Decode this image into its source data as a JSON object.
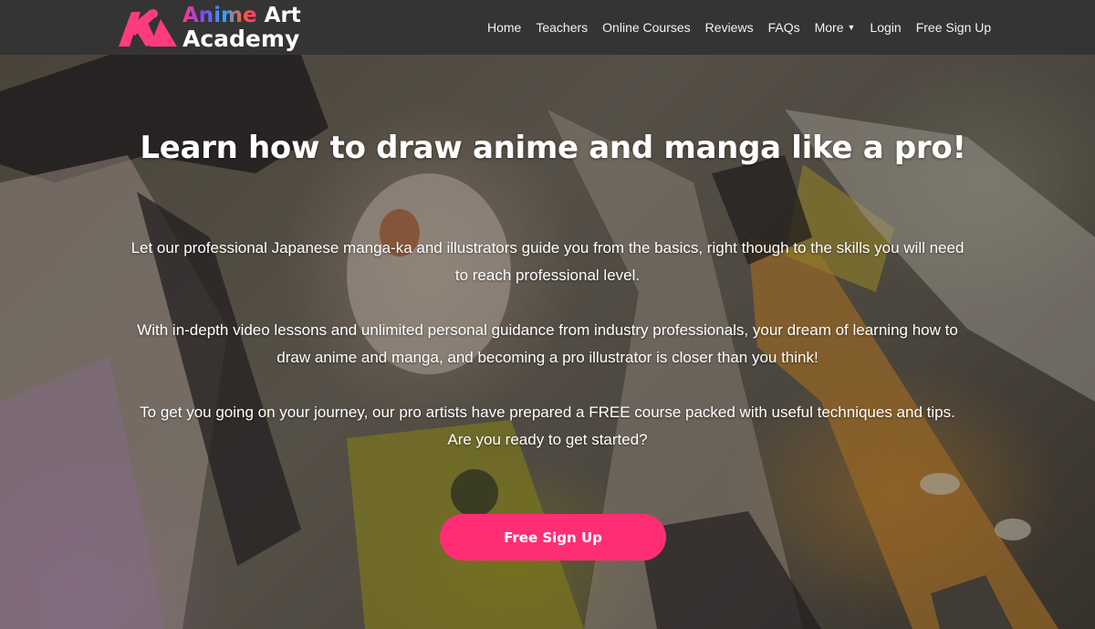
{
  "brand": {
    "line1_part1": "Anime",
    "line1_part2": "Art",
    "line2": "Academy",
    "colors": [
      "#ff3b7f",
      "#7a4bff",
      "#2aa7ff",
      "#ff5a3c"
    ]
  },
  "nav": {
    "items": [
      {
        "label": "Home"
      },
      {
        "label": "Teachers"
      },
      {
        "label": "Online Courses"
      },
      {
        "label": "Reviews"
      },
      {
        "label": "FAQs"
      },
      {
        "label": "More",
        "icon": "caret-down-icon"
      },
      {
        "label": "Login"
      },
      {
        "label": "Free Sign Up"
      }
    ]
  },
  "hero": {
    "headline": "Learn how to draw anime and manga like a pro!",
    "paragraphs": [
      "Let our professional Japanese manga-ka and illustrators guide you from the basics, right though to the skills you will need to reach professional level.",
      "With in-depth video lessons and unlimited personal guidance from industry professionals, your dream of learning how to draw anime and manga, and becoming a pro illustrator is closer than you think!",
      "To get you going on your journey, our pro artists have prepared a FREE course packed with useful techniques and tips. Are you ready to get started?"
    ],
    "cta_label": "Free Sign Up"
  },
  "colors": {
    "nav_bg": "#343434",
    "accent": "#ff2e74",
    "text": "#ffffff"
  }
}
